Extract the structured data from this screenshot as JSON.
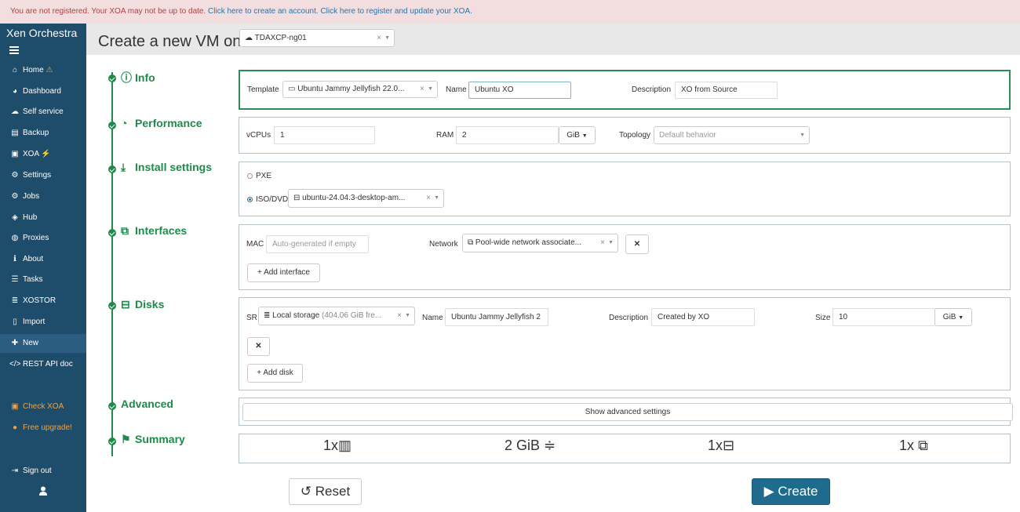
{
  "banner": {
    "text": "You are not registered. Your XOA may not be up to date.",
    "link1": "Click here to create an account.",
    "link2": "Click here to register and update your XOA."
  },
  "sidebar": {
    "brand": "Xen Orchestra",
    "items": [
      {
        "label": "Home",
        "icon": "home-icon"
      },
      {
        "label": "Dashboard",
        "icon": "dashboard-icon"
      },
      {
        "label": "Self service",
        "icon": "cloud-icon"
      },
      {
        "label": "Backup",
        "icon": "backup-icon"
      },
      {
        "label": "XOA",
        "icon": "xoa-icon"
      },
      {
        "label": "Settings",
        "icon": "gear-icon"
      },
      {
        "label": "Jobs",
        "icon": "gears-icon"
      },
      {
        "label": "Hub",
        "icon": "cubes-icon"
      },
      {
        "label": "Proxies",
        "icon": "globe-icon"
      },
      {
        "label": "About",
        "icon": "info-icon"
      },
      {
        "label": "Tasks",
        "icon": "tasks-icon"
      },
      {
        "label": "XOSTOR",
        "icon": "database-icon"
      },
      {
        "label": "Import",
        "icon": "file-icon"
      },
      {
        "label": "New",
        "icon": "plus-icon"
      },
      {
        "label": "REST API doc",
        "icon": "code-icon"
      }
    ],
    "check": "Check XOA",
    "upgrade": "Free upgrade!",
    "signout": "Sign out"
  },
  "page": {
    "title": "Create a new VM on",
    "pool": "TDAXCP-ng01"
  },
  "sections": {
    "info": "Info",
    "performance": "Performance",
    "install": "Install settings",
    "interfaces": "Interfaces",
    "disks": "Disks",
    "advanced": "Advanced",
    "summary": "Summary"
  },
  "info": {
    "template_label": "Template",
    "template_value": "Ubuntu Jammy Jellyfish 22.0...",
    "name_label": "Name",
    "name_value": "Ubuntu XO",
    "desc_label": "Description",
    "desc_value": "XO from Source"
  },
  "performance": {
    "vcpus_label": "vCPUs",
    "vcpus_value": "1",
    "ram_label": "RAM",
    "ram_value": "2",
    "ram_unit": "GiB",
    "topology_label": "Topology",
    "topology_placeholder": "Default behavior"
  },
  "install": {
    "pxe": "PXE",
    "iso": "ISO/DVD",
    "iso_value": "ubuntu-24.04.3-desktop-am..."
  },
  "interfaces": {
    "mac_label": "MAC",
    "mac_placeholder": "Auto-generated if empty",
    "network_label": "Network",
    "network_value": "Pool-wide network associate...",
    "add": "Add interface"
  },
  "disks": {
    "sr_label": "SR",
    "sr_value": "Local storage",
    "sr_free": "(404.06 GiB fre...",
    "name_label": "Name",
    "name_value": "Ubuntu Jammy Jellyfish 2",
    "desc_label": "Description",
    "desc_value": "Created by XO",
    "size_label": "Size",
    "size_value": "10",
    "size_unit": "GiB",
    "add": "Add disk"
  },
  "advanced": {
    "button": "Show advanced settings"
  },
  "summary": {
    "cpus": "1x",
    "ram": "2 GiB",
    "disks": "1x",
    "interfaces": "1x"
  },
  "actions": {
    "reset": "Reset",
    "create": "Create"
  },
  "colors": {
    "sidebar": "#1e4c6b",
    "accent": "#1f8a4c",
    "primary": "#1e6b8e",
    "banner_bg": "#f3dedf",
    "banner_text": "#a94442"
  }
}
